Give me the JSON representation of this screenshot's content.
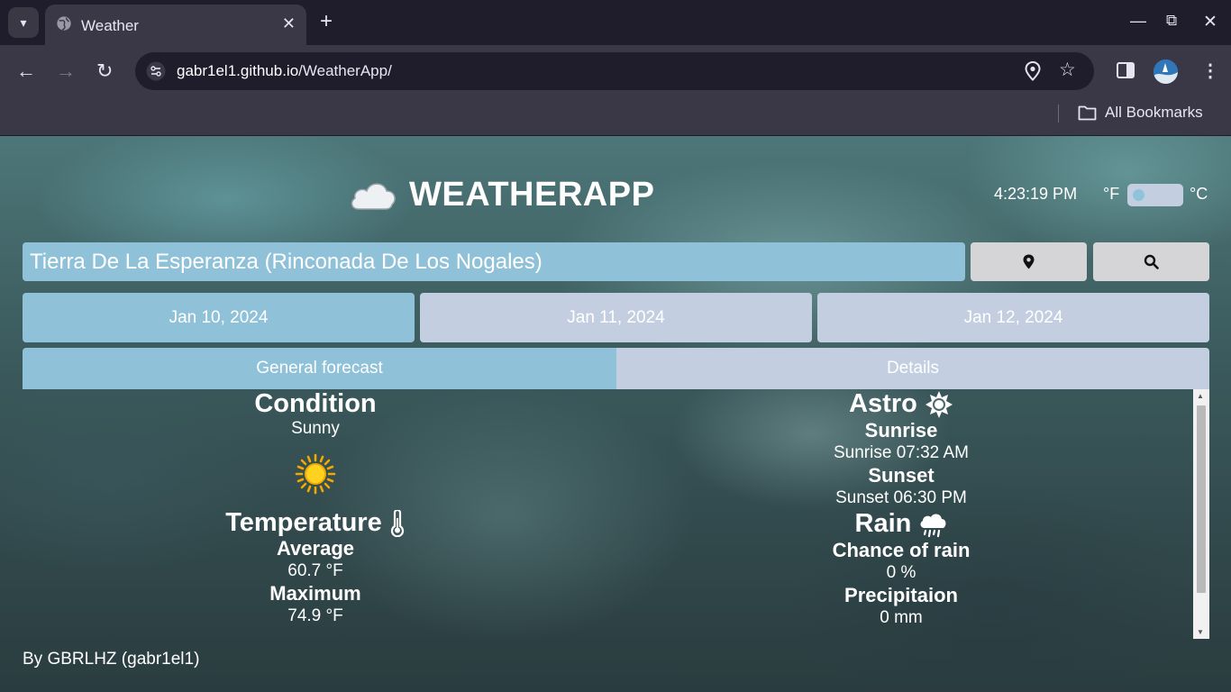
{
  "browser": {
    "tab_title": "Weather",
    "url_host": "gabr1el1.github.io",
    "url_path": "/WeatherApp/",
    "bookmarks_label": "All Bookmarks"
  },
  "app": {
    "title": "WEATHERAPP",
    "clock": "4:23:19 PM",
    "unit_f": "°F",
    "unit_c": "°C",
    "unit_toggle_state": "fahrenheit",
    "location_value": "Tierra De La Esperanza (Rinconada De Los Nogales)",
    "dates": [
      "Jan 10, 2024",
      "Jan 11, 2024",
      "Jan 12, 2024"
    ],
    "active_date_index": 0,
    "views": [
      "General forecast",
      "Details"
    ],
    "active_view_index": 0,
    "colors": {
      "accent": "#8fc1d8",
      "inactive": "#c3cfe0",
      "button": "#d5d5d7"
    }
  },
  "general": {
    "condition_heading": "Condition",
    "condition_value": "Sunny",
    "condition_icon": "sun-icon",
    "temperature_heading": "Temperature",
    "average_label": "Average",
    "average_value": "60.7 °F",
    "maximum_label": "Maximum",
    "maximum_value": "74.9 °F",
    "astro_heading": "Astro",
    "sunrise_label": "Sunrise",
    "sunrise_value": "Sunrise 07:32 AM",
    "sunset_label": "Sunset",
    "sunset_value": "Sunset 06:30 PM",
    "rain_heading": "Rain",
    "chance_label": "Chance of rain",
    "chance_value": "0 %",
    "precip_label": "Precipitaion",
    "precip_value": "0 mm"
  },
  "footer": {
    "credit": "By GBRLHZ (gabr1el1)"
  }
}
